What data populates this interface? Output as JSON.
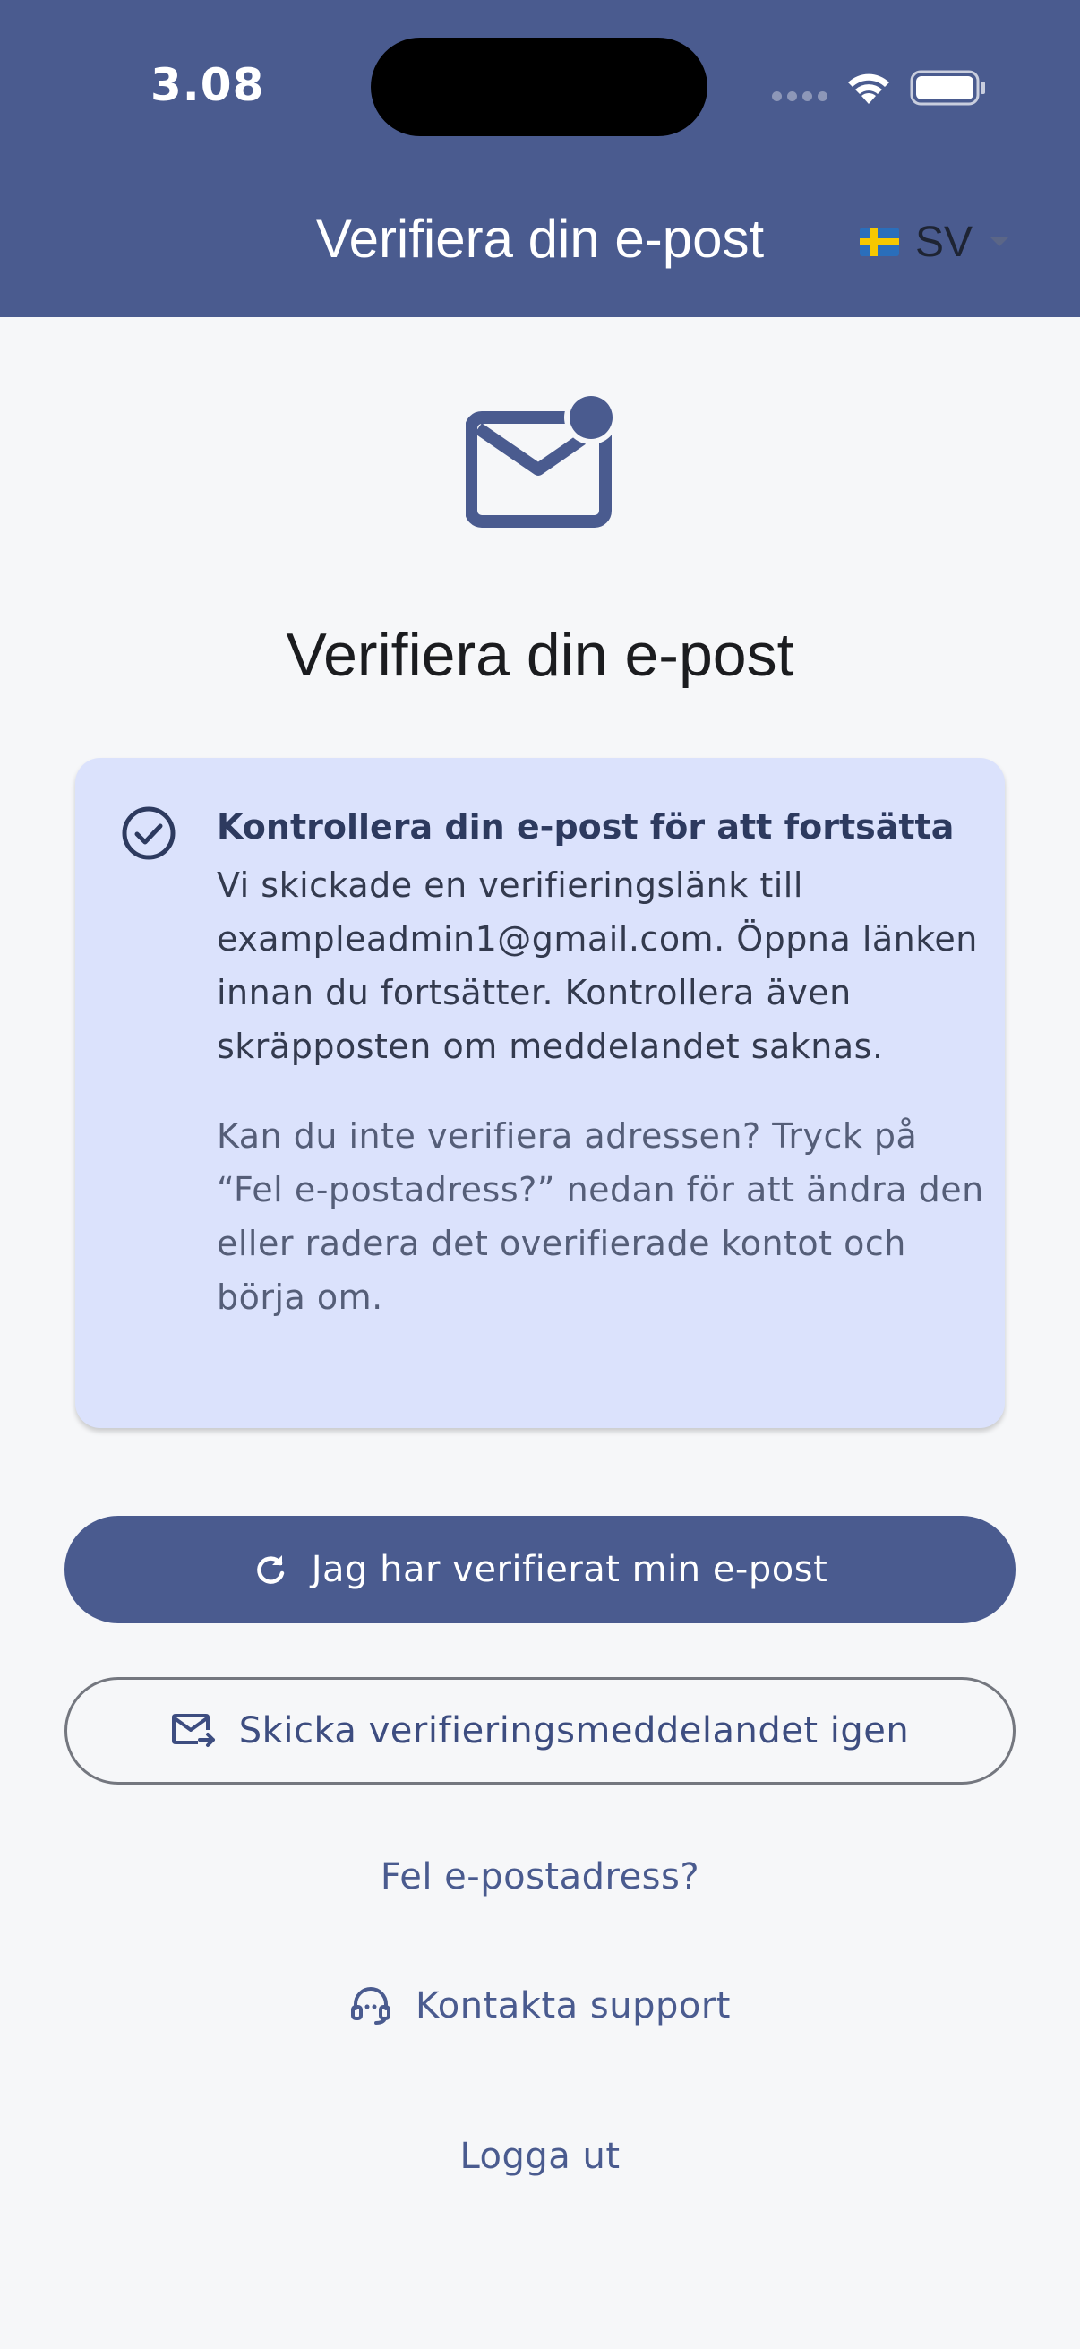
{
  "status_bar": {
    "time": "3.08"
  },
  "header": {
    "title": "Verifiera din e-post",
    "language": {
      "code": "SV",
      "flag_icon": "sweden-flag-icon"
    }
  },
  "main": {
    "title": "Verifiera din e-post",
    "icon": "mail-notification-icon"
  },
  "info_card": {
    "heading": "Kontrollera din e-post för att fortsätta",
    "body": "Vi skickade en verifieringslänk till exampleadmin1@gmail.com. Öppna länken innan du fortsätter. Kontrollera även skräpposten om meddelandet saknas.",
    "note": "Kan du inte verifiera adressen? Tryck på “Fel e-postadress?” nedan för att ändra den eller radera det overifierade kontot och börja om."
  },
  "actions": {
    "verified_button": "Jag har verifierat min e-post",
    "resend_button": "Skicka verifieringsmeddelandet igen",
    "wrong_email_link": "Fel e-postadress?",
    "support_link": "Kontakta support",
    "logout_link": "Logga ut"
  },
  "colors": {
    "primary": "#4a5b8f",
    "card_background": "#dbe2fc",
    "page_background": "#f6f7f9"
  }
}
